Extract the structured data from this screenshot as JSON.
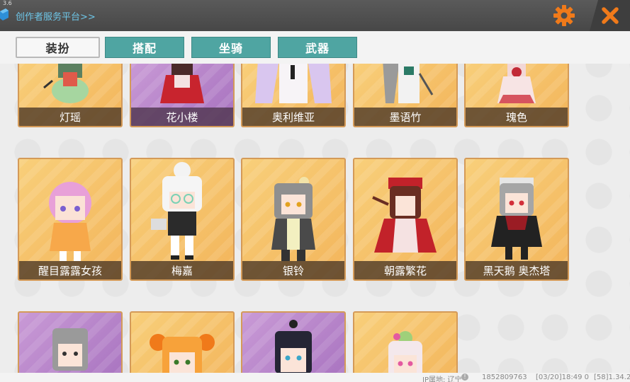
{
  "app": {
    "version_label": "3.6",
    "platform_link": "创作者服务平台>>"
  },
  "tabs": [
    {
      "label": "装扮",
      "active": true
    },
    {
      "label": "搭配",
      "active": false
    },
    {
      "label": "坐骑",
      "active": false
    },
    {
      "label": "武器",
      "active": false
    }
  ],
  "rows": [
    [
      {
        "name": "灯瑶",
        "bg": "orange"
      },
      {
        "name": "花小楼",
        "bg": "purple"
      },
      {
        "name": "奥利维亚",
        "bg": "orange"
      },
      {
        "name": "墨语竹",
        "bg": "orange"
      },
      {
        "name": "瑰色",
        "bg": "orange"
      }
    ],
    [
      {
        "name": "醒目露露女孩",
        "bg": "orange"
      },
      {
        "name": "梅嘉",
        "bg": "orange"
      },
      {
        "name": "银铃",
        "bg": "orange"
      },
      {
        "name": "朝露繁花",
        "bg": "orange"
      },
      {
        "name": "黑天鹅 奥杰塔",
        "bg": "orange"
      }
    ],
    [
      {
        "name": "",
        "bg": "purple"
      },
      {
        "name": "",
        "bg": "orange"
      },
      {
        "name": "",
        "bg": "purple"
      },
      {
        "name": "",
        "bg": "orange"
      }
    ]
  ],
  "status": {
    "ip_location": "IP属地: 辽宁",
    "user_id": "1852809763",
    "timestamp": "[03/20]18:49 0",
    "build": "[58]1.34.2"
  },
  "colors": {
    "accent_orange": "#f07a1a",
    "tab_teal": "#4fa5a2",
    "link_blue": "#6ec6e8"
  }
}
